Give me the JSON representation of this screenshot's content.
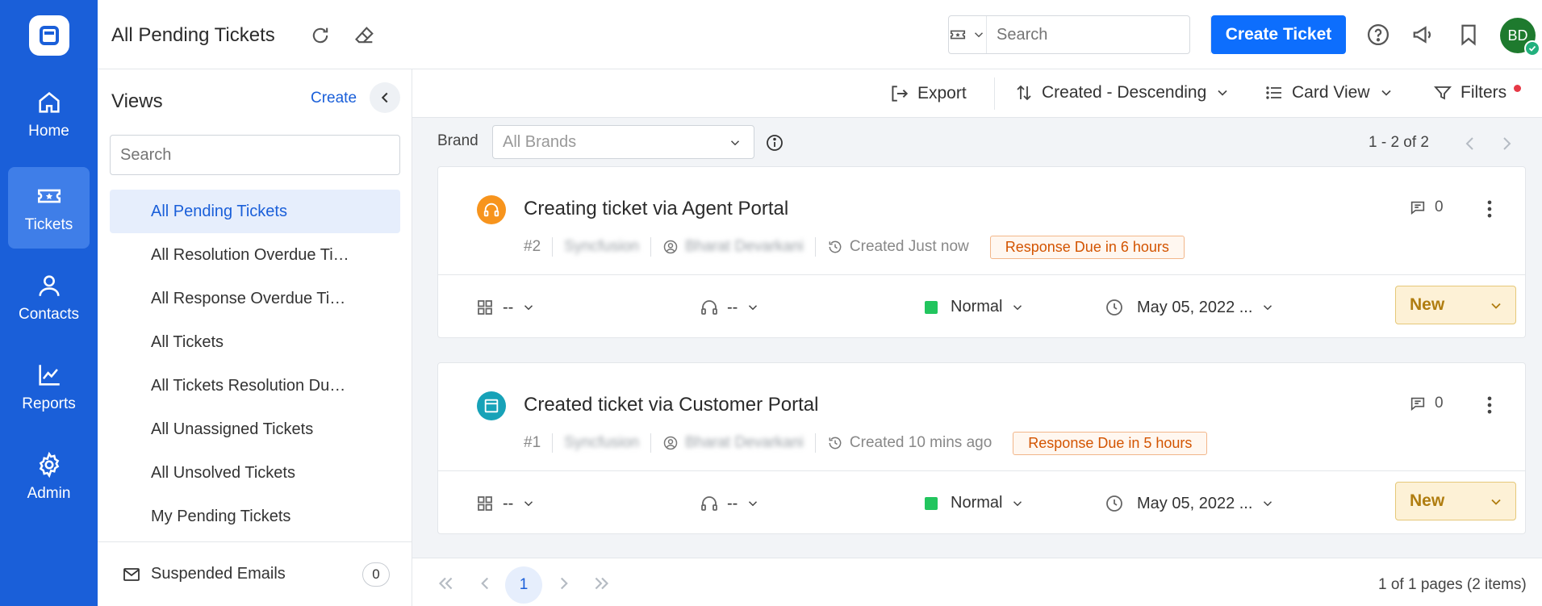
{
  "nav": {
    "items": [
      {
        "label": "Home",
        "icon": "home-icon"
      },
      {
        "label": "Tickets",
        "icon": "ticket-icon"
      },
      {
        "label": "Contacts",
        "icon": "contact-icon"
      },
      {
        "label": "Reports",
        "icon": "reports-icon"
      },
      {
        "label": "Admin",
        "icon": "gear-icon"
      }
    ],
    "active": "Tickets",
    "color": "#1a5fd9"
  },
  "header": {
    "title": "All Pending Tickets",
    "search_placeholder": "Search",
    "create_label": "Create Ticket",
    "avatar_initials": "BD"
  },
  "views": {
    "title": "Views",
    "create_label": "Create",
    "search_placeholder": "Search",
    "items": [
      "All Pending Tickets",
      "All Resolution Overdue Ti…",
      "All Response Overdue Ti…",
      "All Tickets",
      "All Tickets Resolution Du…",
      "All Unassigned Tickets",
      "All Unsolved Tickets",
      "My Pending Tickets"
    ],
    "active_index": 0,
    "suspended_label": "Suspended Emails",
    "suspended_count": "0"
  },
  "toolbar": {
    "export_label": "Export",
    "sort_label": "Created - Descending",
    "view_label": "Card View",
    "filters_label": "Filters"
  },
  "brand": {
    "label": "Brand",
    "placeholder": "All Brands",
    "range": "1 - 2 of 2"
  },
  "tickets": [
    {
      "title": "Creating ticket via Agent Portal",
      "number": "#2",
      "brand": "Syncfusion",
      "agent": "Bharat Devarkani",
      "created": "Created Just now",
      "due": "Response Due in 6 hours",
      "comments": "0",
      "source_icon": "headset-icon",
      "source_color": "#f7941d",
      "category": "--",
      "assignee": "--",
      "priority": "Normal",
      "date": "May 05, 2022 ...",
      "status": "New"
    },
    {
      "title": "Created ticket via Customer Portal",
      "number": "#1",
      "brand": "Syncfusion",
      "agent": "Bharat Devarkani",
      "created": "Created 10 mins ago",
      "due": "Response Due in 5 hours",
      "comments": "0",
      "source_icon": "portal-icon",
      "source_color": "#17a2b8",
      "category": "--",
      "assignee": "--",
      "priority": "Normal",
      "date": "May 05, 2022 ...",
      "status": "New"
    }
  ],
  "pagination": {
    "current": "1",
    "info": "1 of 1 pages (2 items)"
  }
}
